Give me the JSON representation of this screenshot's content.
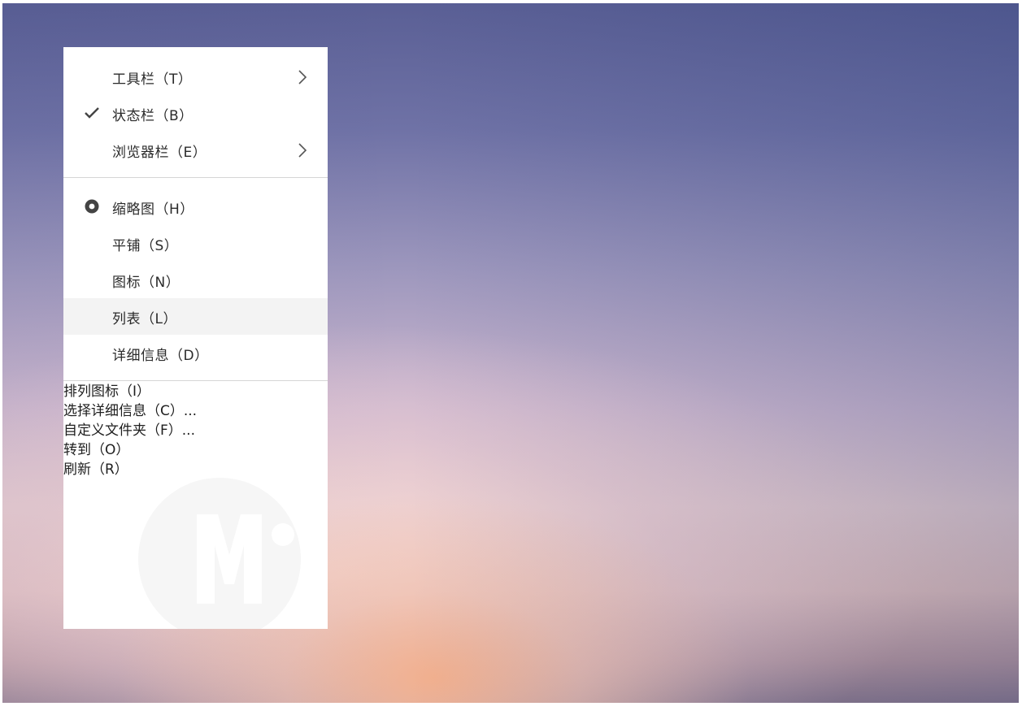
{
  "menu": {
    "view_items": [
      {
        "label": "工具栏（T）",
        "has_submenu": true,
        "state": "none"
      },
      {
        "label": "状态栏（B）",
        "has_submenu": false,
        "state": "checked"
      },
      {
        "label": "浏览器栏（E）",
        "has_submenu": true,
        "state": "none"
      }
    ],
    "layout_items": [
      {
        "label": "缩略图（H）",
        "state": "selected-radio"
      },
      {
        "label": "平铺（S）",
        "state": "none"
      },
      {
        "label": "图标（N）",
        "state": "none"
      },
      {
        "label": "列表（L）",
        "state": "hover"
      },
      {
        "label": "详细信息（D）",
        "state": "none"
      }
    ],
    "extra_items": [
      {
        "label": "排列图标（I）"
      },
      {
        "label": "选择详细信息（C）..."
      },
      {
        "label": "自定义文件夹（F）..."
      },
      {
        "label": "转到（O）"
      },
      {
        "label": "刷新（R）"
      }
    ]
  },
  "icons": {
    "submenu": "chevron-right-icon",
    "check": "checkmark-icon",
    "radio": "radio-dot-icon"
  },
  "colors": {
    "menu_background": "#ffffff",
    "hover_background": "#f3f3f3",
    "separator": "#d6d6d6",
    "text": "#2b2b2b",
    "icon": "#444444"
  }
}
